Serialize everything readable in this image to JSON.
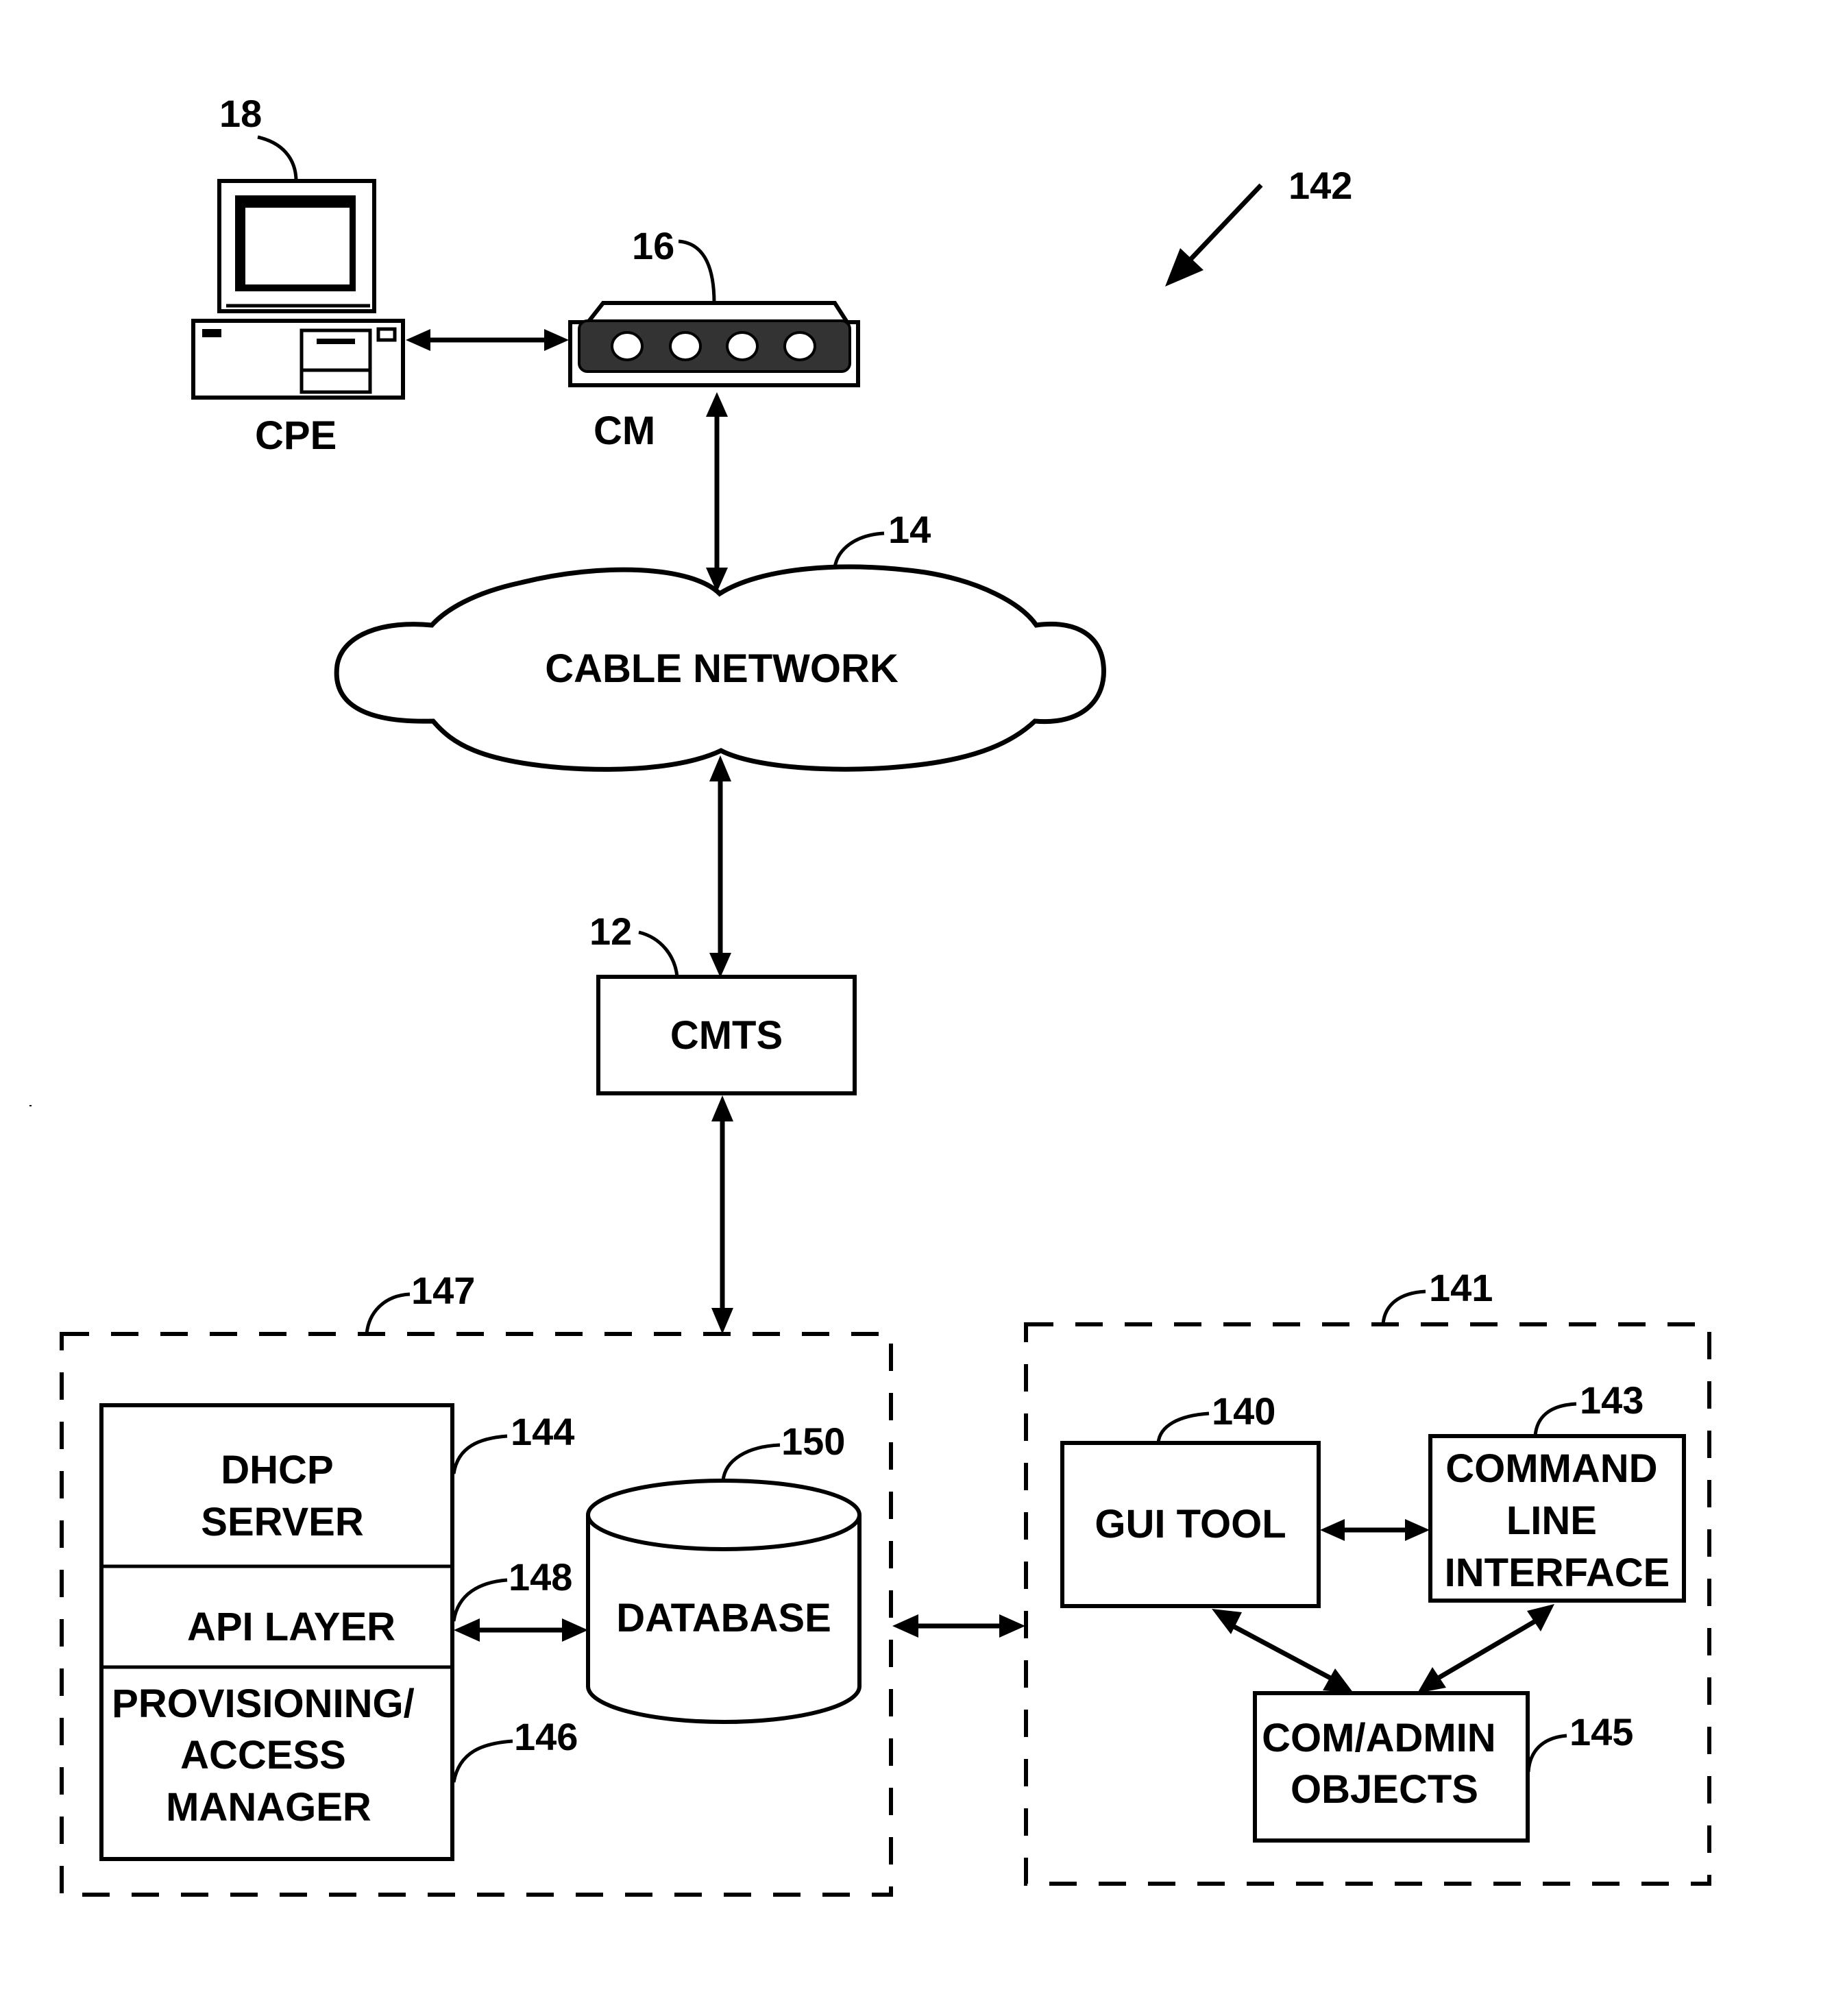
{
  "figure": {
    "reference": "142",
    "colors": {
      "ink": "#000000",
      "background": "#ffffff"
    }
  },
  "nodes": {
    "cpe": {
      "label": "CPE",
      "ref": "18",
      "icon": "desktop-computer-icon"
    },
    "cm": {
      "label": "CM",
      "ref": "16",
      "icon": "cable-modem-icon"
    },
    "cable_network": {
      "label": "CABLE NETWORK",
      "ref": "14",
      "icon": "cloud-icon"
    },
    "cmts": {
      "label": "CMTS",
      "ref": "12"
    },
    "server_group": {
      "ref": "147",
      "stack": {
        "dhcp": {
          "lines": [
            "DHCP",
            "SERVER"
          ],
          "ref": "144"
        },
        "api": {
          "label": "API LAYER",
          "ref": "148"
        },
        "provisioning": {
          "lines": [
            "PROVISIONING/",
            "ACCESS",
            "MANAGER"
          ],
          "ref": "146"
        }
      },
      "database": {
        "label": "DATABASE",
        "ref": "150",
        "icon": "database-cylinder-icon"
      }
    },
    "admin_group": {
      "ref": "141",
      "gui_tool": {
        "label": "GUI TOOL",
        "ref": "140"
      },
      "cli": {
        "lines": [
          "COMMAND",
          "LINE",
          "INTERFACE"
        ],
        "ref": "143"
      },
      "com_admin": {
        "lines": [
          "COM/ADMIN",
          "OBJECTS"
        ],
        "ref": "145"
      }
    }
  },
  "connections": [
    {
      "from": "CPE",
      "to": "CM",
      "type": "bidirectional"
    },
    {
      "from": "CM",
      "to": "CABLE NETWORK",
      "type": "bidirectional"
    },
    {
      "from": "CABLE NETWORK",
      "to": "CMTS",
      "type": "bidirectional"
    },
    {
      "from": "CMTS",
      "to": "server_group",
      "type": "bidirectional"
    },
    {
      "from": "API LAYER",
      "to": "DATABASE",
      "type": "bidirectional"
    },
    {
      "from": "server_group",
      "to": "admin_group",
      "type": "bidirectional"
    },
    {
      "from": "GUI TOOL",
      "to": "COMMAND LINE INTERFACE",
      "type": "bidirectional"
    },
    {
      "from": "GUI TOOL",
      "to": "COM/ADMIN OBJECTS",
      "type": "bidirectional"
    },
    {
      "from": "COMMAND LINE INTERFACE",
      "to": "COM/ADMIN OBJECTS",
      "type": "bidirectional"
    }
  ]
}
